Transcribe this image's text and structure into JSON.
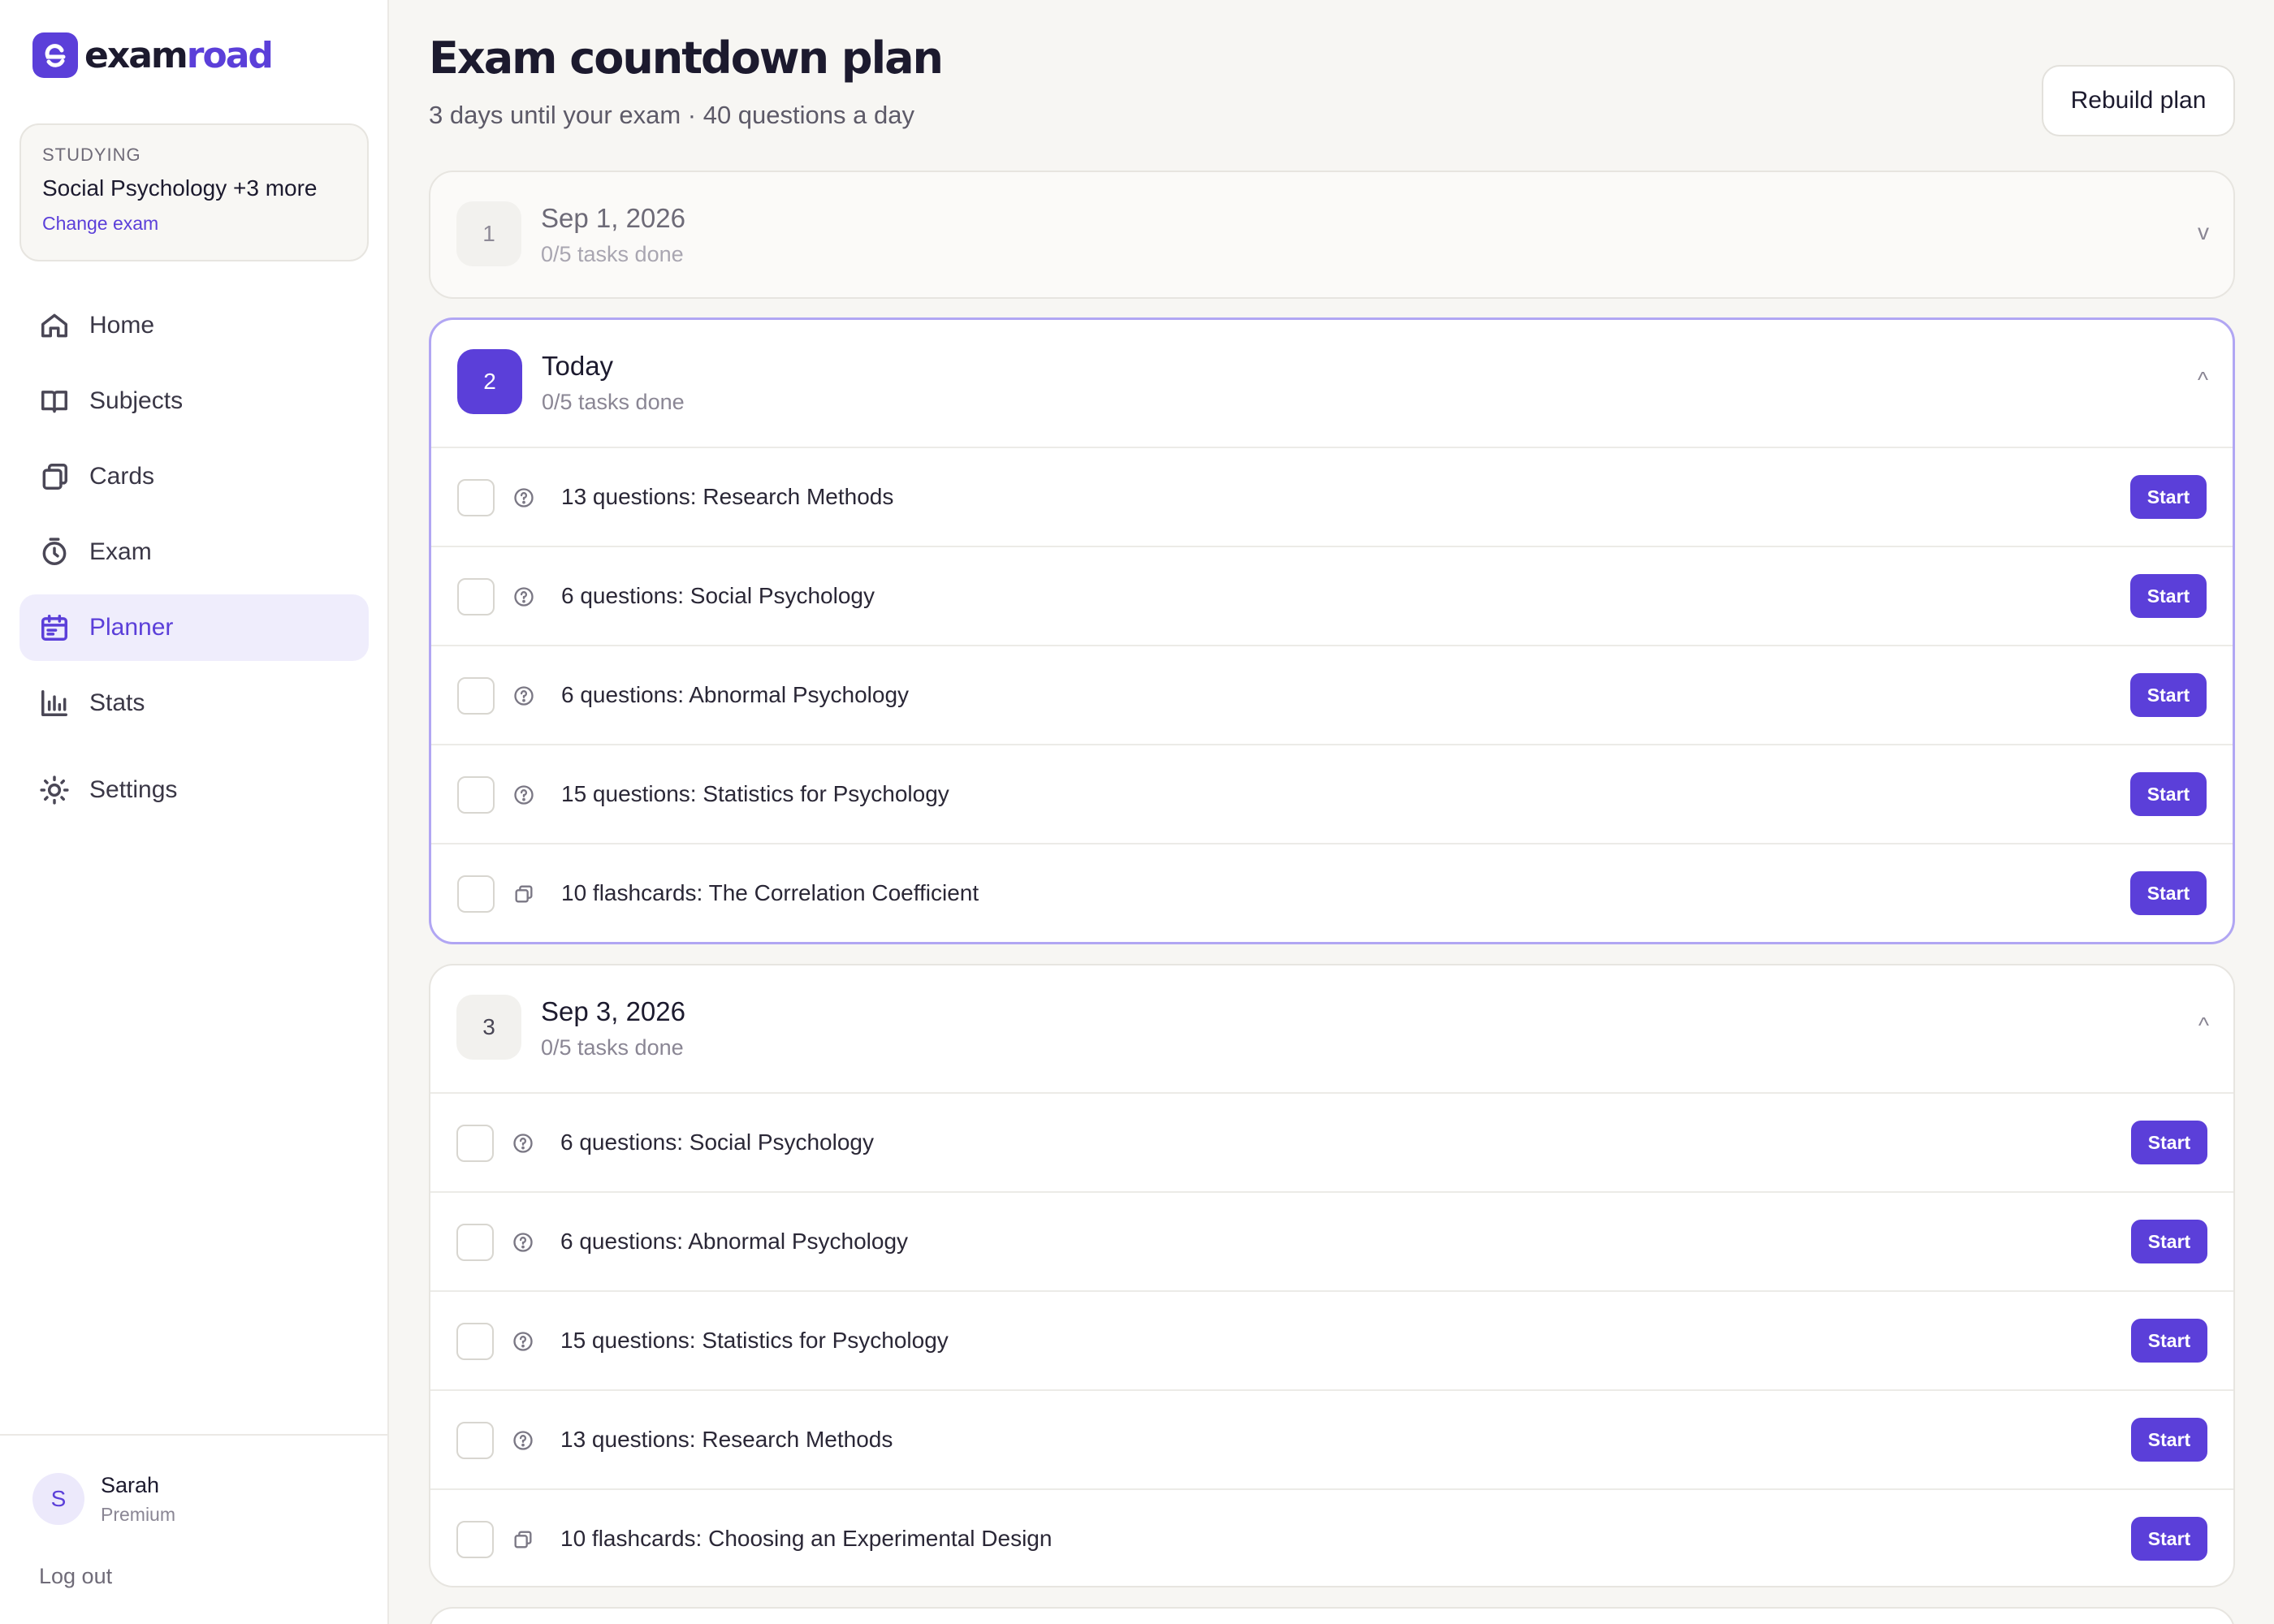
{
  "brand": {
    "part1": "exam",
    "part2": "road",
    "accent": "#5b3fd9"
  },
  "studying": {
    "tag": "STUDYING",
    "name": "Social Psychology +3 more",
    "change_label": "Change exam"
  },
  "nav": {
    "home": "Home",
    "subjects": "Subjects",
    "cards": "Cards",
    "exam": "Exam",
    "planner": "Planner",
    "stats": "Stats",
    "settings": "Settings"
  },
  "user": {
    "initial": "S",
    "name": "Sarah",
    "plan": "Premium",
    "logout": "Log out"
  },
  "header": {
    "title": "Exam countdown plan",
    "subtitle": "3 days until your exam · 40 questions a day",
    "rebuild_label": "Rebuild plan"
  },
  "days": [
    {
      "number": "1",
      "title": "Sep 1, 2026",
      "progress": "0/5 tasks done",
      "chevron": "v",
      "expanded": false
    },
    {
      "number": "2",
      "title": "Today",
      "progress": "0/5 tasks done",
      "chevron": "^",
      "expanded": true,
      "tasks": [
        {
          "icon": "question-circle-icon",
          "label": "13 questions: Research Methods",
          "action": "Start"
        },
        {
          "icon": "question-circle-icon",
          "label": "6 questions: Social Psychology",
          "action": "Start"
        },
        {
          "icon": "question-circle-icon",
          "label": "6 questions: Abnormal Psychology",
          "action": "Start"
        },
        {
          "icon": "question-circle-icon",
          "label": "15 questions: Statistics for Psychology",
          "action": "Start"
        },
        {
          "icon": "cards-icon",
          "label": "10 flashcards: The Correlation Coefficient",
          "action": "Start"
        }
      ]
    },
    {
      "number": "3",
      "title": "Sep 3, 2026",
      "progress": "0/5 tasks done",
      "chevron": "^",
      "expanded": true,
      "tasks": [
        {
          "icon": "question-circle-icon",
          "label": "6 questions: Social Psychology",
          "action": "Start"
        },
        {
          "icon": "question-circle-icon",
          "label": "6 questions: Abnormal Psychology",
          "action": "Start"
        },
        {
          "icon": "question-circle-icon",
          "label": "15 questions: Statistics for Psychology",
          "action": "Start"
        },
        {
          "icon": "question-circle-icon",
          "label": "13 questions: Research Methods",
          "action": "Start"
        },
        {
          "icon": "cards-icon",
          "label": "10 flashcards: Choosing an Experimental Design",
          "action": "Start"
        }
      ]
    }
  ]
}
